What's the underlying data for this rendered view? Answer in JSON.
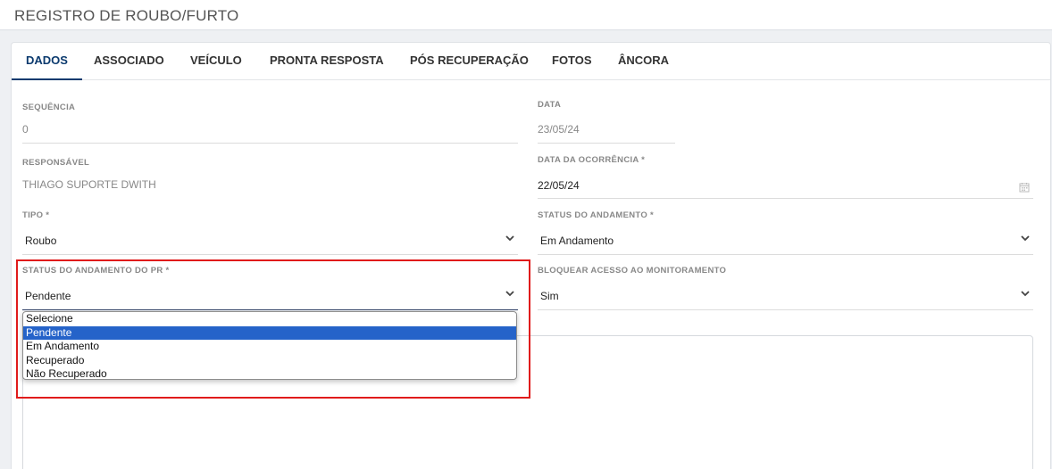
{
  "header": {
    "title": "REGISTRO DE ROUBO/FURTO"
  },
  "tabs": [
    {
      "label": "DADOS"
    },
    {
      "label": "ASSOCIADO"
    },
    {
      "label": "VEÍCULO"
    },
    {
      "label": "PRONTA RESPOSTA"
    },
    {
      "label": "PÓS RECUPERAÇÃO"
    },
    {
      "label": "FOTOS"
    },
    {
      "label": "ÂNCORA"
    }
  ],
  "form": {
    "sequencia": {
      "label": "SEQUÊNCIA",
      "value": "0"
    },
    "data": {
      "label": "DATA",
      "value": "23/05/24"
    },
    "responsavel": {
      "label": "RESPONSÁVEL",
      "value": "THIAGO SUPORTE DWITH"
    },
    "data_ocorrencia": {
      "label": "DATA DA OCORRÊNCIA *",
      "value": "22/05/24"
    },
    "tipo": {
      "label": "TIPO *",
      "value": "Roubo"
    },
    "status_andamento": {
      "label": "STATUS DO ANDAMENTO *",
      "value": "Em Andamento"
    },
    "status_andamento_pr": {
      "label": "STATUS DO ANDAMENTO DO PR *",
      "value": "Pendente",
      "options": [
        "Selecione",
        "Pendente",
        "Em Andamento",
        "Recuperado",
        "Não Recuperado"
      ],
      "selected_index": 1
    },
    "bloquear_acesso": {
      "label": "BLOQUEAR ACESSO AO MONITORAMENTO",
      "value": "Sim"
    }
  },
  "colors": {
    "accent": "#0b3a6e",
    "highlight": "#e01b1b",
    "option_selected": "#2563c9"
  }
}
